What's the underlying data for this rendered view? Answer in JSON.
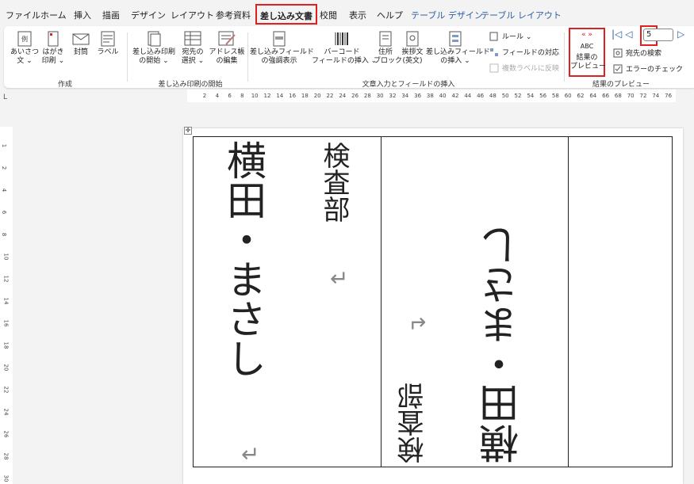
{
  "tabs": [
    {
      "label": "ファイル",
      "active": false
    },
    {
      "label": "ホーム",
      "active": false
    },
    {
      "label": "挿入",
      "active": false
    },
    {
      "label": "描画",
      "active": false
    },
    {
      "label": "デザイン",
      "active": false
    },
    {
      "label": "レイアウト",
      "active": false
    },
    {
      "label": "参考資料",
      "active": false
    },
    {
      "label": "差し込み文書",
      "active": true
    },
    {
      "label": "校閲",
      "active": false
    },
    {
      "label": "表示",
      "active": false
    },
    {
      "label": "ヘルプ",
      "active": false
    },
    {
      "label": "テーブル デザイン",
      "active": false
    },
    {
      "label": "テーブル レイアウト",
      "active": false
    }
  ],
  "ribbon": {
    "create": {
      "buttons": [
        {
          "l1": "あいさつ",
          "l2": "文 ⌄"
        },
        {
          "l1": "はがき",
          "l2": "印刷 ⌄"
        },
        {
          "l1": "封筒",
          "l2": ""
        },
        {
          "l1": "ラベル",
          "l2": ""
        }
      ],
      "group": "作成"
    },
    "start": {
      "buttons": [
        {
          "l1": "差し込み印刷",
          "l2": "の開始 ⌄"
        },
        {
          "l1": "宛先の",
          "l2": "選択 ⌄"
        },
        {
          "l1": "アドレス帳",
          "l2": "の編集"
        }
      ],
      "group": "差し込み印刷の開始"
    },
    "write": {
      "buttons": [
        {
          "l1": "差し込みフィールド",
          "l2": "の強調表示"
        },
        {
          "l1": "バーコード",
          "l2": "フィールドの挿入 ⌄"
        },
        {
          "l1": "住所",
          "l2": "ブロック"
        },
        {
          "l1": "挨拶文",
          "l2": "(英文)"
        },
        {
          "l1": "差し込みフィールド",
          "l2": "の挿入 ⌄"
        }
      ],
      "small": {
        "rules": "ルール ⌄",
        "match": "フィールドの対応",
        "update": "複数ラベルに反映"
      },
      "group": "文章入力とフィールドの挿入"
    },
    "preview": {
      "abc": "ABC",
      "l1": "結果の",
      "l2": "プレビュー",
      "record": "5",
      "find": "宛先の検索",
      "check": "エラーのチェック",
      "group": "結果のプレビュー"
    }
  },
  "ruler": {
    "top_marks": [
      "2",
      "4",
      "6",
      "8",
      "10",
      "12",
      "14",
      "16",
      "18",
      "20",
      "22",
      "24",
      "26",
      "28",
      "30",
      "32",
      "34",
      "36",
      "38",
      "40",
      "42",
      "44",
      "46",
      "48",
      "50",
      "52",
      "54",
      "56",
      "58",
      "60",
      "62",
      "64",
      "66",
      "68",
      "70",
      "72",
      "74",
      "76"
    ],
    "left_marks": [
      "1",
      "2",
      "4",
      "6",
      "8",
      "10",
      "12",
      "14",
      "16",
      "18",
      "20",
      "22",
      "24",
      "26",
      "28",
      "30"
    ]
  },
  "document": {
    "left_name": "横田・まさし",
    "left_dept": "検査部",
    "right_name": "横田・まさし",
    "right_dept": "検査部",
    "return_mark": "↵"
  },
  "colors": {
    "accent_red": "#e02020",
    "context_tab_blue": "#2e5ea6"
  }
}
